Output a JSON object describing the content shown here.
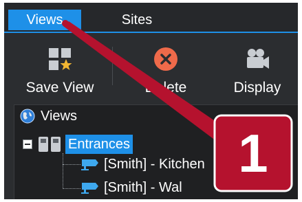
{
  "tabs": {
    "views": "Views",
    "sites": "Sites",
    "active": "Views"
  },
  "toolbar": {
    "save_view": "Save View",
    "delete": "Delete",
    "display": "Display"
  },
  "tree": {
    "root": "Views",
    "group": "Entrances",
    "group_expanded": true,
    "items": [
      "[Smith] - Kitchen",
      "[Smith] - Wal"
    ]
  },
  "callout": {
    "number": "1",
    "color": "#b5122e"
  },
  "colors": {
    "accent": "#1e90e8",
    "delete_icon": "#ef6a4a",
    "background": "#2b2d30"
  },
  "icons": [
    "save-view-icon",
    "delete-icon",
    "display-camera-icon",
    "globe-icon",
    "collapse-minus-icon",
    "cameras-group-icon",
    "camera-icon"
  ]
}
